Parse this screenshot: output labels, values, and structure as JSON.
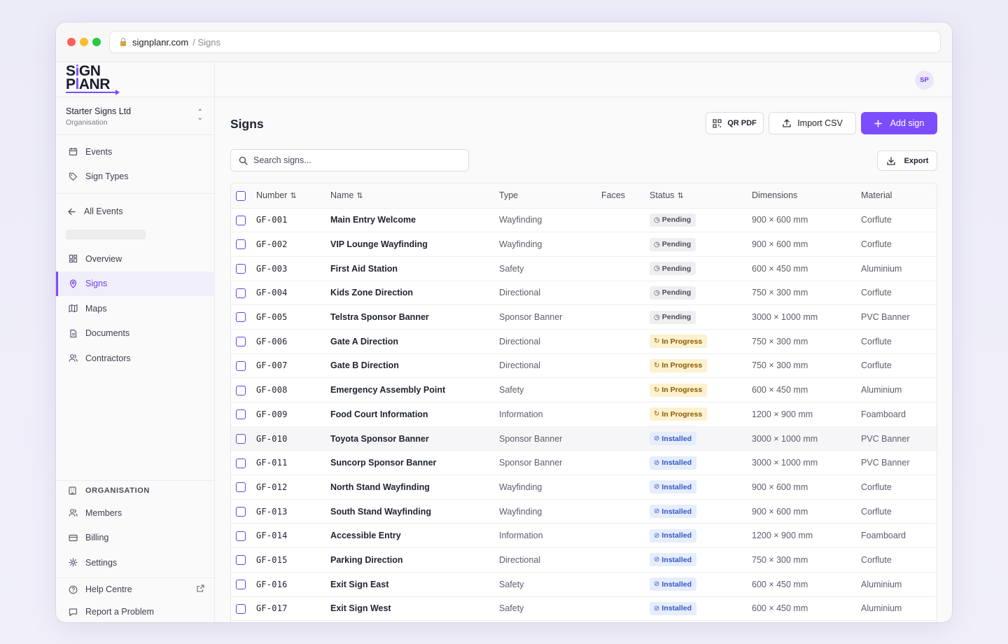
{
  "browser": {
    "host": "signplanr.com",
    "path": "/ Signs"
  },
  "brand": {
    "line1_a": "S",
    "line1_i": "i",
    "line1_b": "GN",
    "line2_a": "P",
    "line2_i": "l",
    "line2_b": "ANR",
    "accent": "#7c4dff"
  },
  "org": {
    "name": "Starter Signs Ltd",
    "sub": "Organisation"
  },
  "nav_top": [
    {
      "label": "Events",
      "icon": "calendar-icon"
    },
    {
      "label": "Sign Types",
      "icon": "tag-icon"
    }
  ],
  "back_label": "All Events",
  "nav_event": [
    {
      "label": "Overview",
      "icon": "grid-icon"
    },
    {
      "label": "Signs",
      "icon": "map-pin-icon",
      "active": true
    },
    {
      "label": "Maps",
      "icon": "map-icon"
    },
    {
      "label": "Documents",
      "icon": "document-icon"
    },
    {
      "label": "Contractors",
      "icon": "users-icon"
    }
  ],
  "org_section": {
    "header": "ORGANISATION",
    "items": [
      {
        "label": "Members",
        "icon": "users-icon"
      },
      {
        "label": "Billing",
        "icon": "credit-card-icon"
      },
      {
        "label": "Settings",
        "icon": "gear-icon"
      }
    ]
  },
  "help": [
    {
      "label": "Help Centre",
      "icon": "help-circle-icon"
    },
    {
      "label": "Report a Problem",
      "icon": "message-icon"
    }
  ],
  "user": {
    "initials": "SP"
  },
  "page": {
    "title": "Signs"
  },
  "actions": {
    "qr_pdf": "QR PDF",
    "import_csv": "Import CSV",
    "add_sign": "Add sign",
    "export": "Export"
  },
  "search": {
    "placeholder": "Search signs..."
  },
  "table": {
    "columns": [
      "Number",
      "Name",
      "Type",
      "Faces",
      "Status",
      "Dimensions",
      "Material"
    ],
    "rows": [
      {
        "number": "GF-001",
        "name": "Main Entry Welcome",
        "type": "Wayfinding",
        "faces": "",
        "status": "Pending",
        "dims": "900 × 600 mm",
        "material": "Corflute"
      },
      {
        "number": "GF-002",
        "name": "VIP Lounge Wayfinding",
        "type": "Wayfinding",
        "faces": "",
        "status": "Pending",
        "dims": "900 × 600 mm",
        "material": "Corflute"
      },
      {
        "number": "GF-003",
        "name": "First Aid Station",
        "type": "Safety",
        "faces": "",
        "status": "Pending",
        "dims": "600 × 450 mm",
        "material": "Aluminium"
      },
      {
        "number": "GF-004",
        "name": "Kids Zone Direction",
        "type": "Directional",
        "faces": "",
        "status": "Pending",
        "dims": "750 × 300 mm",
        "material": "Corflute"
      },
      {
        "number": "GF-005",
        "name": "Telstra Sponsor Banner",
        "type": "Sponsor Banner",
        "faces": "",
        "status": "Pending",
        "dims": "3000 × 1000 mm",
        "material": "PVC Banner"
      },
      {
        "number": "GF-006",
        "name": "Gate A Direction",
        "type": "Directional",
        "faces": "",
        "status": "In Progress",
        "dims": "750 × 300 mm",
        "material": "Corflute"
      },
      {
        "number": "GF-007",
        "name": "Gate B Direction",
        "type": "Directional",
        "faces": "",
        "status": "In Progress",
        "dims": "750 × 300 mm",
        "material": "Corflute"
      },
      {
        "number": "GF-008",
        "name": "Emergency Assembly Point",
        "type": "Safety",
        "faces": "",
        "status": "In Progress",
        "dims": "600 × 450 mm",
        "material": "Aluminium"
      },
      {
        "number": "GF-009",
        "name": "Food Court Information",
        "type": "Information",
        "faces": "",
        "status": "In Progress",
        "dims": "1200 × 900 mm",
        "material": "Foamboard"
      },
      {
        "number": "GF-010",
        "name": "Toyota Sponsor Banner",
        "type": "Sponsor Banner",
        "faces": "",
        "status": "Installed",
        "dims": "3000 × 1000 mm",
        "material": "PVC Banner",
        "highlight": true
      },
      {
        "number": "GF-011",
        "name": "Suncorp Sponsor Banner",
        "type": "Sponsor Banner",
        "faces": "",
        "status": "Installed",
        "dims": "3000 × 1000 mm",
        "material": "PVC Banner"
      },
      {
        "number": "GF-012",
        "name": "North Stand Wayfinding",
        "type": "Wayfinding",
        "faces": "",
        "status": "Installed",
        "dims": "900 × 600 mm",
        "material": "Corflute"
      },
      {
        "number": "GF-013",
        "name": "South Stand Wayfinding",
        "type": "Wayfinding",
        "faces": "",
        "status": "Installed",
        "dims": "900 × 600 mm",
        "material": "Corflute"
      },
      {
        "number": "GF-014",
        "name": "Accessible Entry",
        "type": "Information",
        "faces": "",
        "status": "Installed",
        "dims": "1200 × 900 mm",
        "material": "Foamboard"
      },
      {
        "number": "GF-015",
        "name": "Parking Direction",
        "type": "Directional",
        "faces": "",
        "status": "Installed",
        "dims": "750 × 300 mm",
        "material": "Corflute"
      },
      {
        "number": "GF-016",
        "name": "Exit Sign East",
        "type": "Safety",
        "faces": "",
        "status": "Installed",
        "dims": "600 × 450 mm",
        "material": "Aluminium"
      },
      {
        "number": "GF-017",
        "name": "Exit Sign West",
        "type": "Safety",
        "faces": "",
        "status": "Installed",
        "dims": "600 × 450 mm",
        "material": "Aluminium"
      }
    ]
  },
  "status_colors": {
    "Pending": "#efeff1",
    "In Progress": "#fdf1cf",
    "Installed": "#e6edfd"
  }
}
